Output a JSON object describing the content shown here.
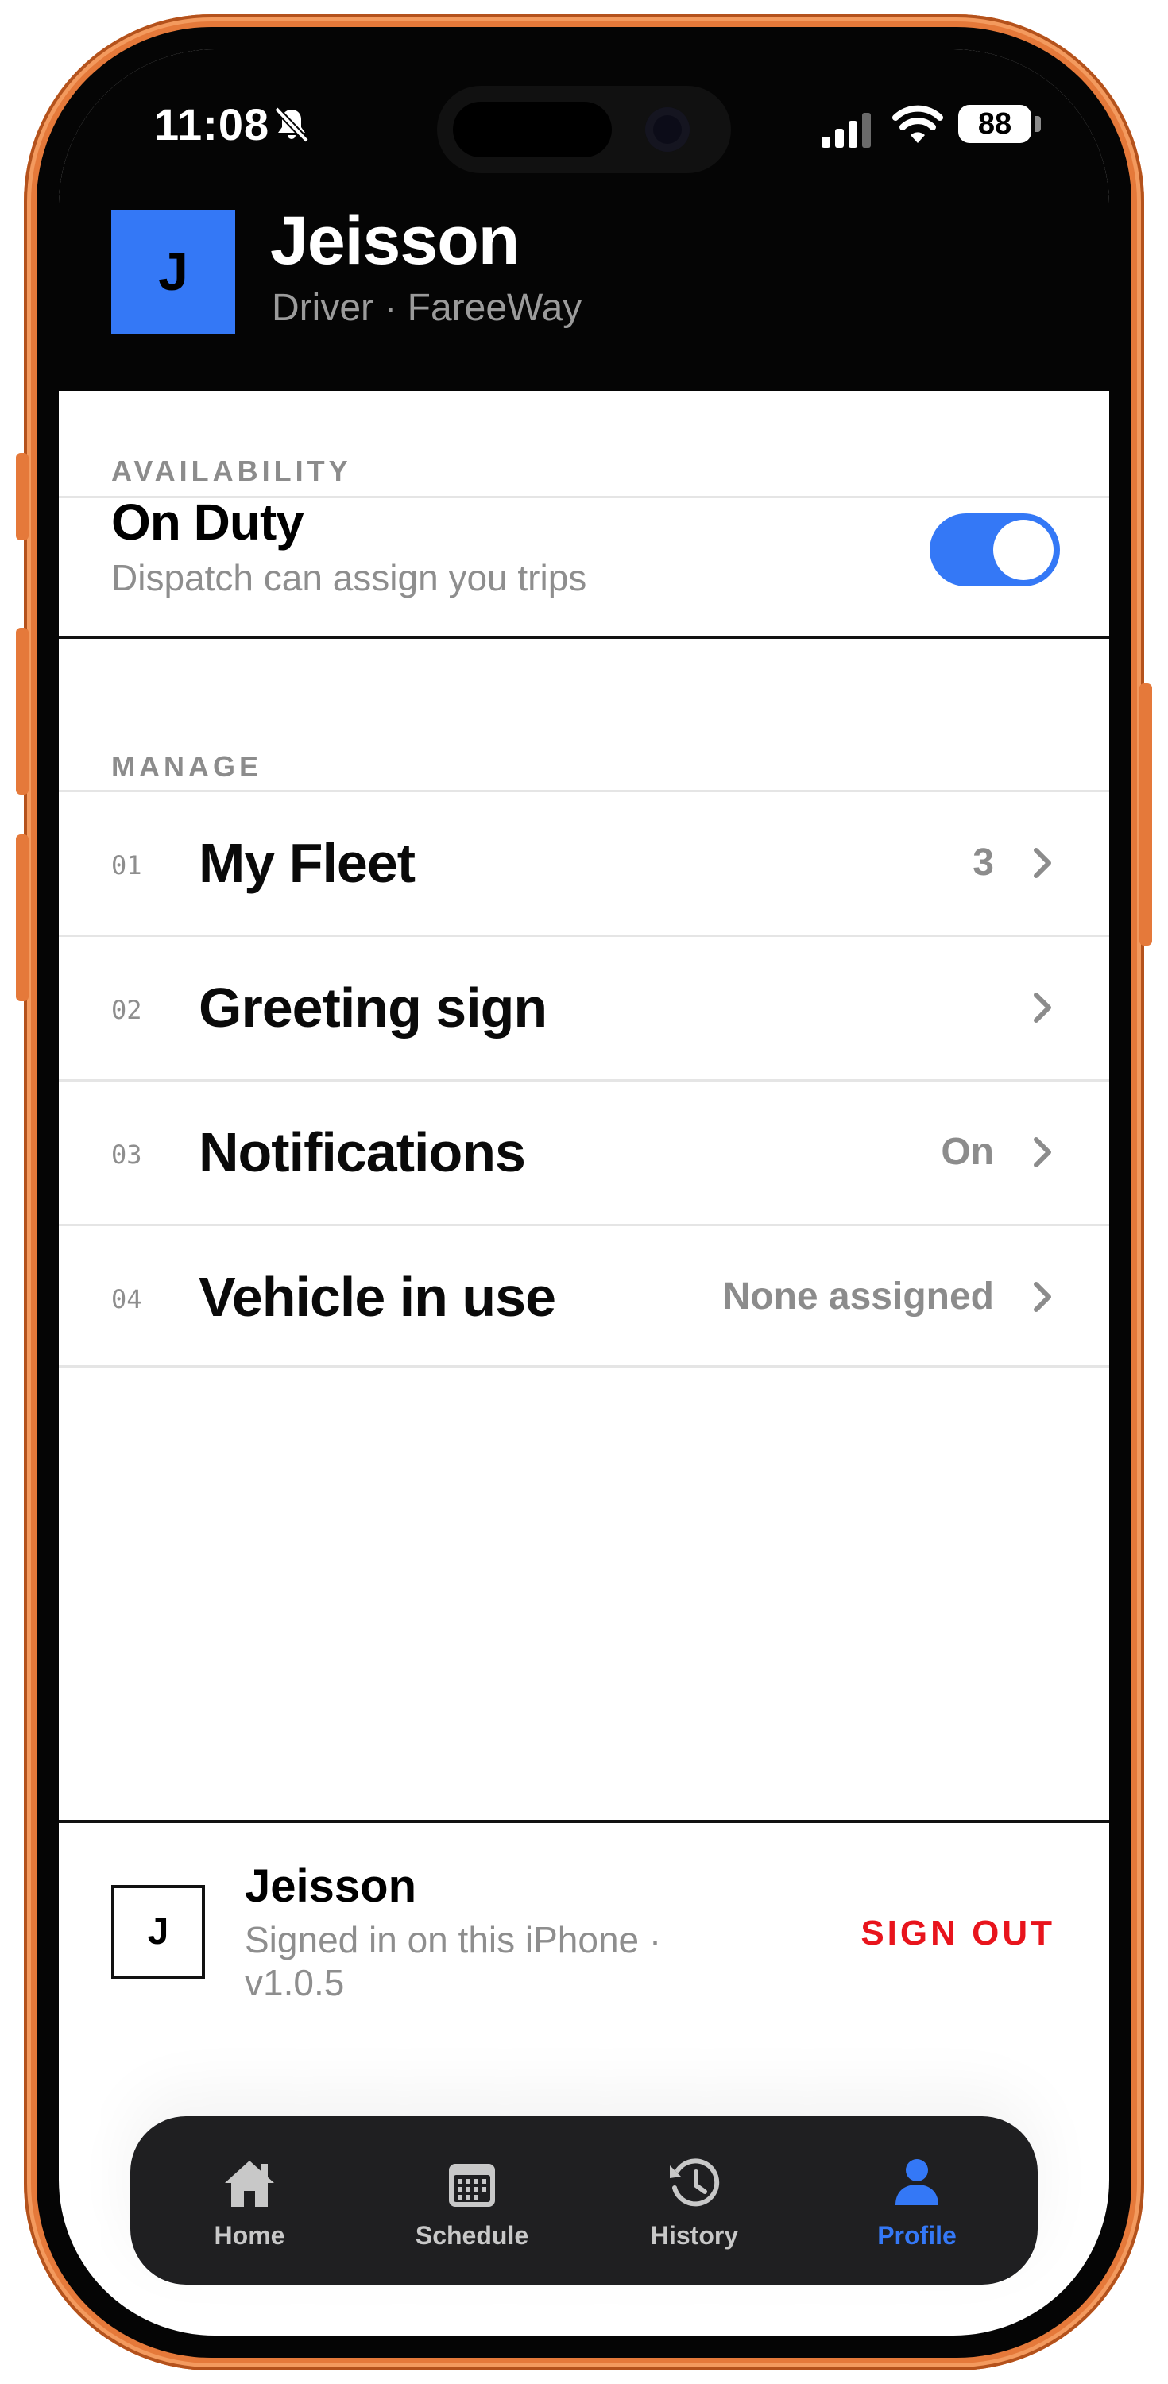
{
  "status_bar": {
    "time": "11:08",
    "battery": "88"
  },
  "header": {
    "avatar_initial": "J",
    "name": "Jeisson",
    "subtitle": "Driver · FareeWay"
  },
  "availability": {
    "section_label": "AVAILABILITY",
    "title": "On Duty",
    "subtitle": "Dispatch can assign you trips",
    "toggle_on": true
  },
  "manage": {
    "section_label": "MANAGE",
    "items": [
      {
        "num": "01",
        "title": "My Fleet",
        "value": "3"
      },
      {
        "num": "02",
        "title": "Greeting sign",
        "value": ""
      },
      {
        "num": "03",
        "title": "Notifications",
        "value": "On"
      },
      {
        "num": "04",
        "title": "Vehicle in use",
        "value": "None assigned"
      }
    ]
  },
  "account": {
    "avatar_initial": "J",
    "name": "Jeisson",
    "subtitle": "Signed in on this iPhone · v1.0.5",
    "sign_out_label": "SIGN OUT"
  },
  "tabbar": {
    "tabs": [
      {
        "label": "Home",
        "icon": "home-icon",
        "active": false
      },
      {
        "label": "Schedule",
        "icon": "calendar-icon",
        "active": false
      },
      {
        "label": "History",
        "icon": "history-icon",
        "active": false
      },
      {
        "label": "Profile",
        "icon": "person-icon",
        "active": true
      }
    ]
  },
  "colors": {
    "accent": "#3478f6",
    "danger": "#e8141c",
    "frame": "#e5793a"
  }
}
